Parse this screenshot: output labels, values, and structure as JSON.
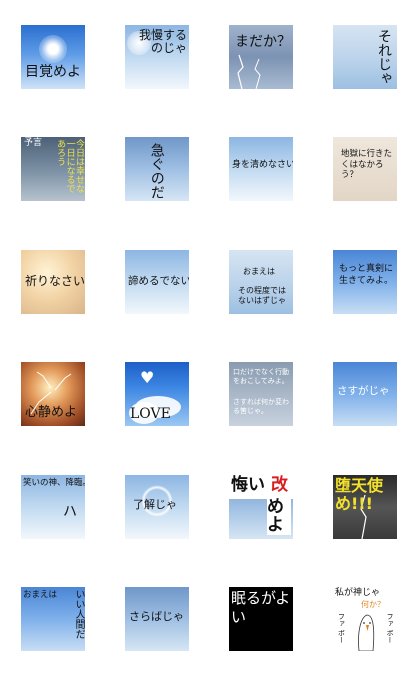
{
  "stickers": [
    {
      "text": "目覚めよ"
    },
    {
      "text": "我慢するのじゃ"
    },
    {
      "text": "まだか？"
    },
    {
      "text": "それじゃ"
    },
    {
      "label": "予言",
      "text": "今日は幸せな一日になるであろう"
    },
    {
      "text": "急ぐのだ"
    },
    {
      "text": "身を清めなさい"
    },
    {
      "text": "地獄に行きたくはなかろう？"
    },
    {
      "text": "祈りなさい"
    },
    {
      "text": "諦めるでない"
    },
    {
      "line1": "おまえは",
      "line2": "その程度ではないはずじゃ"
    },
    {
      "text": "もっと真剣に生きてみよ。"
    },
    {
      "text": "心静めよ"
    },
    {
      "text": "LOVE"
    },
    {
      "line1": "口だけでなく行動をおこしてみよ。",
      "line2": "さすれば何か変わる筈じゃ。"
    },
    {
      "text": "さすがじゃ"
    },
    {
      "text": "笑いの神、降臨。",
      "mark": "ハ"
    },
    {
      "text": "了解じゃ"
    },
    {
      "text_a": "悔い",
      "text_b": "改",
      "text_c": "めよ"
    },
    {
      "text": "堕天使め!!!"
    },
    {
      "line1": "おまえは",
      "line2": "いい人間だ"
    },
    {
      "text": "さらばじゃ"
    },
    {
      "text": "眠るがよい"
    },
    {
      "line1": "私が神じゃ",
      "line2": "何か？",
      "left": "ファ ボー",
      "right": "ファ ボー"
    }
  ]
}
